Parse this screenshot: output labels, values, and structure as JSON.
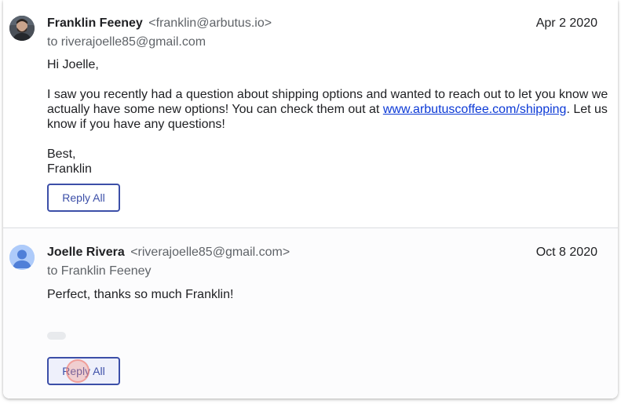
{
  "messages": [
    {
      "sender_name": "Franklin Feeney",
      "sender_email": "<franklin@arbutus.io>",
      "date": "Apr 2 2020",
      "to": "to riverajoelle85@gmail.com",
      "greeting": "Hi Joelle,",
      "para_before_link": "I saw you recently had a question about shipping options and wanted to reach out to let you know we actually have some new options! You can check them out at ",
      "link_text": "www.arbutuscoffee.com/shipping",
      "para_after_link": ". Let us know if you have any questions!",
      "signoff": "Best,",
      "signature": "Franklin",
      "reply_label": "Reply All"
    },
    {
      "sender_name": "Joelle Rivera",
      "sender_email": "<riverajoelle85@gmail.com>",
      "date": "Oct 8 2020",
      "to": "to Franklin Feeney",
      "body": "Perfect, thanks so much Franklin!",
      "reply_label": "Reply All"
    }
  ],
  "colors": {
    "accent": "#3c4fa8",
    "link": "#0b39d6",
    "muted_text": "#5f6368",
    "avatar_default": "#aecbfa"
  },
  "icons": {
    "avatar_1": "photo-avatar",
    "avatar_2": "person-avatar-icon"
  }
}
